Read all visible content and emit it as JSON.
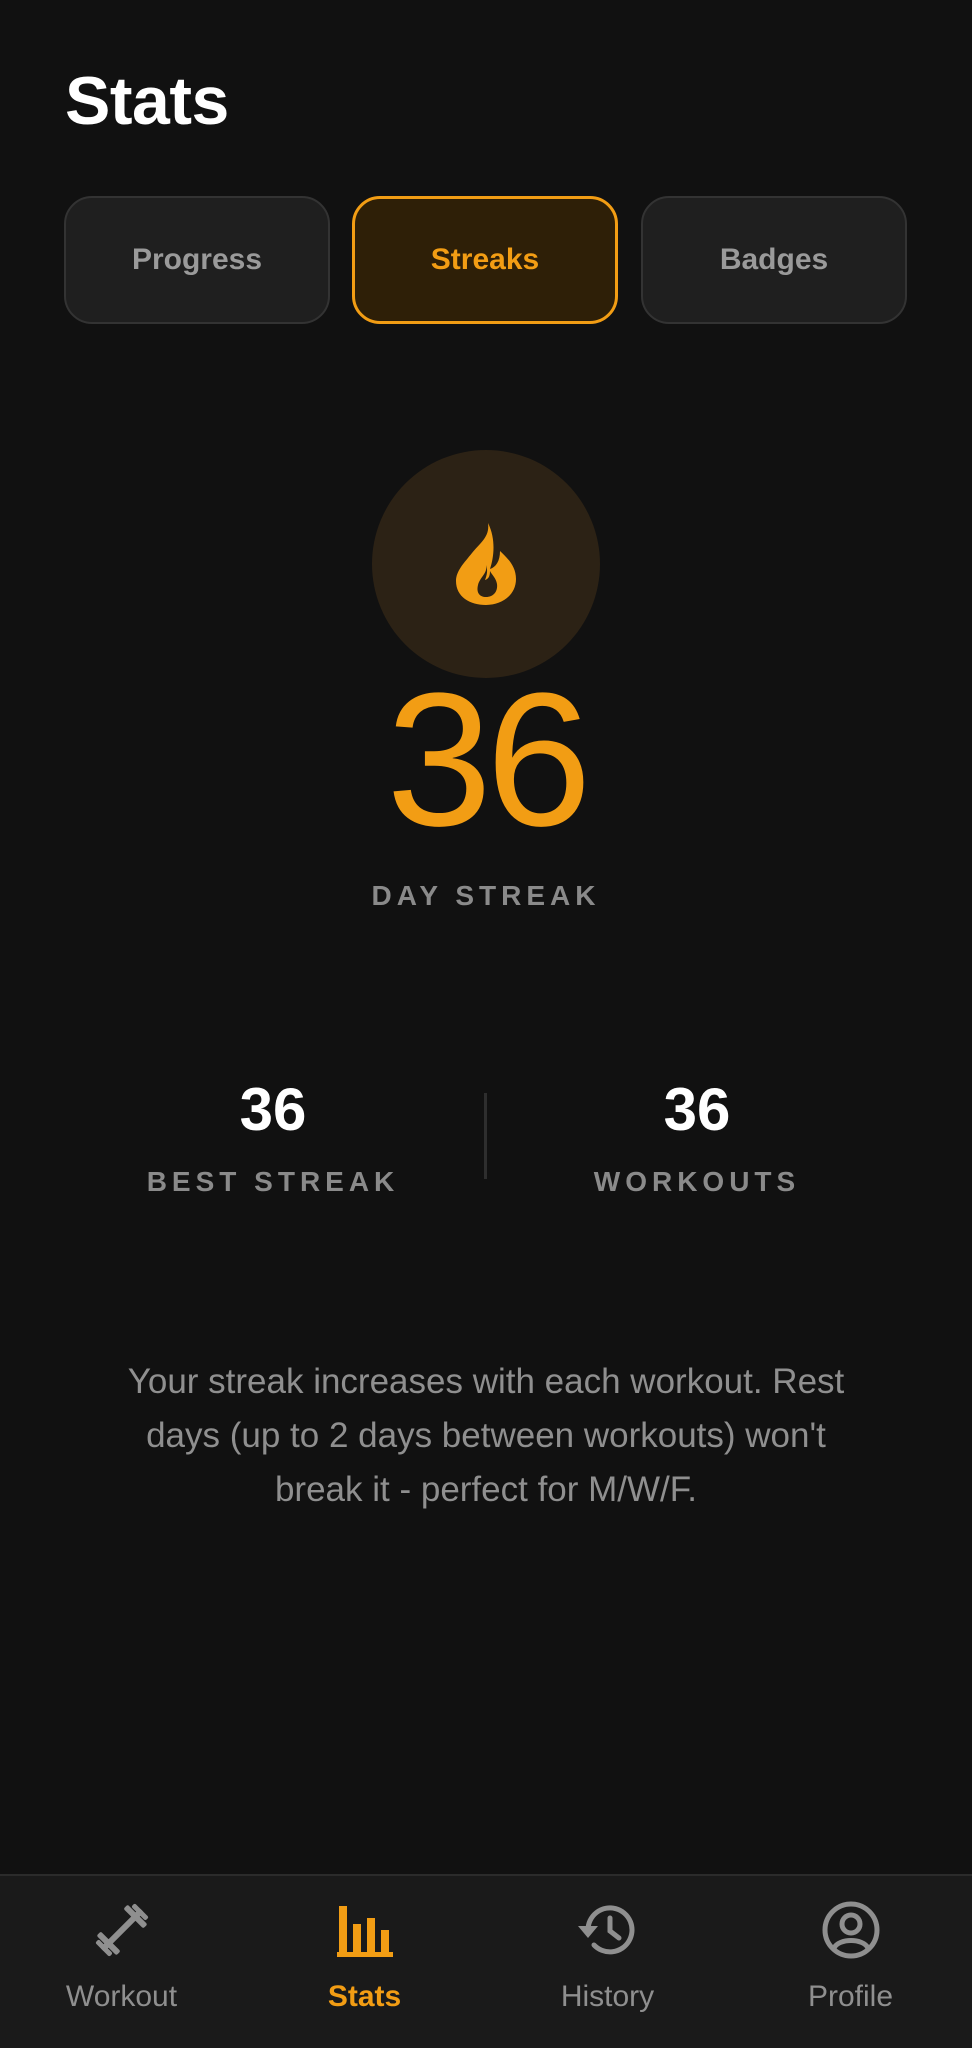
{
  "header": {
    "title": "Stats"
  },
  "tabs": [
    {
      "label": "Progress",
      "active": false
    },
    {
      "label": "Streaks",
      "active": true
    },
    {
      "label": "Badges",
      "active": false
    }
  ],
  "streak": {
    "icon": "flame-icon",
    "current": "36",
    "label": "DAY STREAK"
  },
  "stats": {
    "best": {
      "value": "36",
      "label": "BEST STREAK"
    },
    "workouts": {
      "value": "36",
      "label": "WORKOUTS"
    }
  },
  "info": {
    "text": "Your streak increases with each workout. Rest days (up to 2 days between workouts) won't break it - perfect for M/W/F."
  },
  "nav": {
    "items": [
      {
        "label": "Workout",
        "icon": "dumbbell-icon",
        "active": false
      },
      {
        "label": "Stats",
        "icon": "bar-chart-icon",
        "active": true
      },
      {
        "label": "History",
        "icon": "history-icon",
        "active": false
      },
      {
        "label": "Profile",
        "icon": "profile-icon",
        "active": false
      }
    ]
  },
  "colors": {
    "background": "#111111",
    "accent": "#f29d14",
    "muted_text": "#8f8f8f",
    "nav_background": "#1a1a1a"
  }
}
